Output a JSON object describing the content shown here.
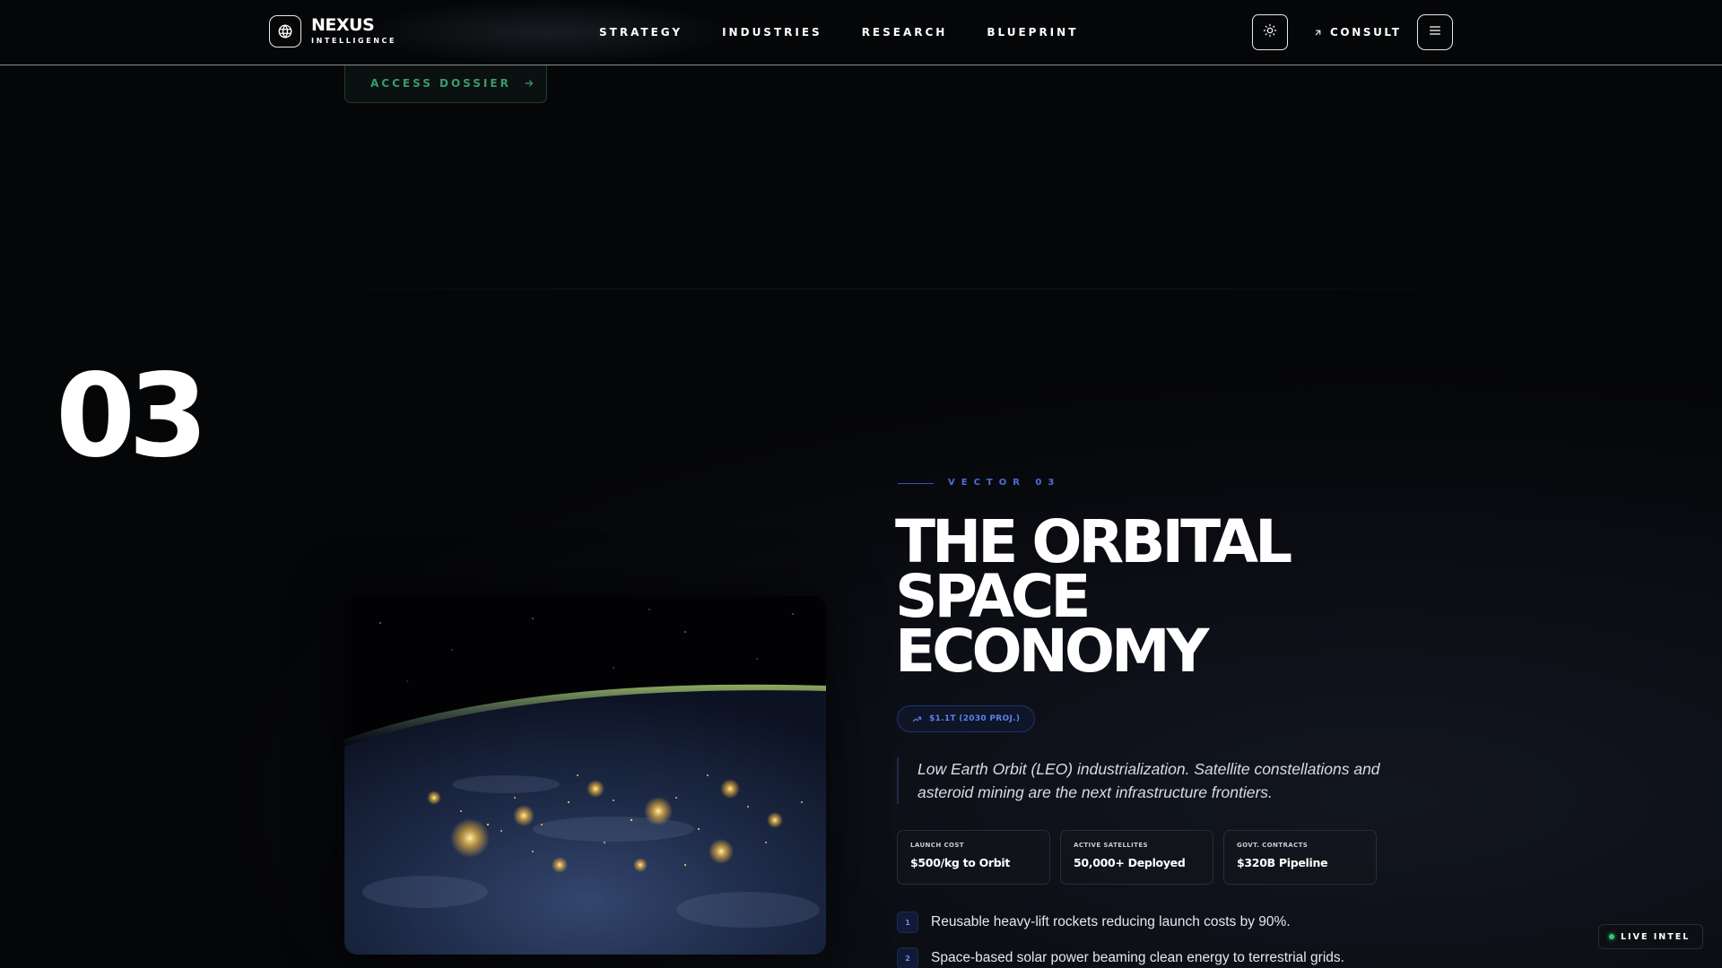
{
  "header": {
    "brand_name": "NEXUS",
    "brand_sub": "INTELLIGENCE",
    "nav": [
      "STRATEGY",
      "INDUSTRIES",
      "RESEARCH",
      "BLUEPRINT"
    ],
    "consult_label": "CONSULT",
    "icons": {
      "brand": "globe-icon",
      "theme": "sun-icon",
      "consult": "arrow-up-right-icon",
      "menu": "menu-icon"
    }
  },
  "previous_section": {
    "cta_label": "ACCESS DOSSIER",
    "cta_icon": "arrow-right-icon"
  },
  "section": {
    "number": "03",
    "vector_label": "VECTOR 03",
    "headline": [
      "THE ORBITAL",
      "SPACE",
      "ECONOMY"
    ],
    "pill_label": "$1.1T (2030 PROJ.)",
    "pill_icon": "trending-up-icon",
    "quote": "Low Earth Orbit (LEO) industrialization. Satellite constellations and asteroid mining are the next infrastructure frontiers.",
    "image_subject": "earth-at-night-from-orbit",
    "stats": [
      {
        "label": "LAUNCH COST",
        "value": "$500/kg to Orbit"
      },
      {
        "label": "ACTIVE SATELLITES",
        "value": "50,000+ Deployed"
      },
      {
        "label": "GOVT. CONTRACTS",
        "value": "$320B Pipeline"
      }
    ],
    "points": [
      {
        "num": "1",
        "text": "Reusable heavy-lift rockets reducing launch costs by 90%."
      },
      {
        "num": "2",
        "text": "Space-based solar power beaming clean energy to terrestrial grids."
      }
    ]
  },
  "live_badge": {
    "label": "LIVE INTEL",
    "color": "#2ecc71"
  },
  "colors": {
    "background": "#050608",
    "accent_blue": "#4d70d8",
    "accent_green": "#3a9a6e"
  }
}
